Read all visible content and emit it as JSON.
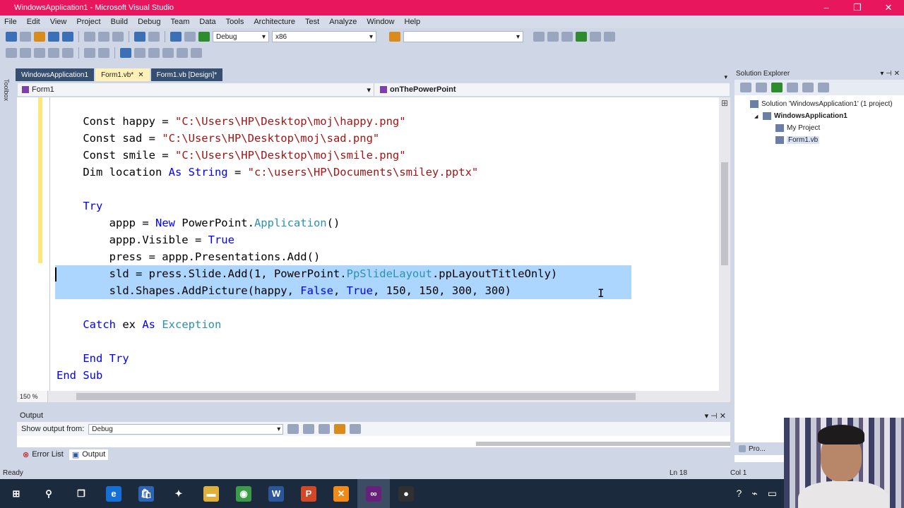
{
  "window": {
    "title": "WindowsApplication1 - Microsoft Visual Studio",
    "controls": [
      "–",
      "❐",
      "✕"
    ]
  },
  "menu": [
    "File",
    "Edit",
    "View",
    "Project",
    "Build",
    "Debug",
    "Team",
    "Data",
    "Tools",
    "Architecture",
    "Test",
    "Analyze",
    "Window",
    "Help"
  ],
  "toolbar": {
    "config": "Debug",
    "platform": "x86",
    "find": ""
  },
  "toolbox_label": "Toolbox",
  "tabs": [
    {
      "label": "WindowsApplication1",
      "active": false
    },
    {
      "label": "Form1.vb*",
      "active": true
    },
    {
      "label": "Form1.vb [Design]*",
      "active": false
    }
  ],
  "navbar": {
    "left": "Form1",
    "right": "onThePowerPoint"
  },
  "code": {
    "lines": [
      [
        {
          "t": "    Const happy = "
        },
        {
          "t": "\"C:\\Users\\HP\\Desktop\\moj\\happy.png\"",
          "c": "str"
        }
      ],
      [
        {
          "t": "    Const sad = "
        },
        {
          "t": "\"C:\\Users\\HP\\Desktop\\moj\\sad.png\"",
          "c": "str"
        }
      ],
      [
        {
          "t": "    Const smile = "
        },
        {
          "t": "\"C:\\Users\\HP\\Desktop\\moj\\smile.png\"",
          "c": "str"
        }
      ],
      [
        {
          "t": "    Dim location ",
          "c": ""
        },
        {
          "t": "As String",
          "c": "kw"
        },
        {
          "t": " = "
        },
        {
          "t": "\"c:\\users\\HP\\Documents\\smiley.pptx\"",
          "c": "str"
        }
      ],
      [
        {
          "t": ""
        }
      ],
      [
        {
          "t": "    Try",
          "c": "kw"
        }
      ],
      [
        {
          "t": "        appp = "
        },
        {
          "t": "New",
          "c": "kw"
        },
        {
          "t": " PowerPoint."
        },
        {
          "t": "Application",
          "c": "ty"
        },
        {
          "t": "()"
        }
      ],
      [
        {
          "t": "        appp.Visible = "
        },
        {
          "t": "True",
          "c": "kw"
        }
      ],
      [
        {
          "t": "        press = appp.Presentations.Add()"
        }
      ],
      [
        {
          "t": "        sld = press.Slide.Add(1, PowerPoint."
        },
        {
          "t": "PpSlideLayout",
          "c": "ty"
        },
        {
          "t": ".ppLayoutTitleOnly)"
        }
      ],
      [
        {
          "t": "        sld.Shapes.AddPicture(happy, "
        },
        {
          "t": "False",
          "c": "kw"
        },
        {
          "t": ", "
        },
        {
          "t": "True",
          "c": "kw"
        },
        {
          "t": ", 150, 150, 300, 300)"
        }
      ],
      [
        {
          "t": ""
        }
      ],
      [
        {
          "t": "    Catch",
          "c": "kw"
        },
        {
          "t": " ex "
        },
        {
          "t": "As",
          "c": "kw"
        },
        {
          "t": " "
        },
        {
          "t": "Exception",
          "c": "ty"
        }
      ],
      [
        {
          "t": ""
        }
      ],
      [
        {
          "t": "    End Try",
          "c": "kw"
        }
      ],
      [
        {
          "t": "End Sub",
          "c": "kw"
        }
      ]
    ]
  },
  "zoom": "150 %",
  "solution_explorer": {
    "title": "Solution Explorer",
    "items": [
      {
        "label": "Solution 'WindowsApplication1' (1 project)",
        "indent": 0,
        "bold": false,
        "selected": false
      },
      {
        "label": "WindowsApplication1",
        "indent": 1,
        "bold": true,
        "selected": false
      },
      {
        "label": "My Project",
        "indent": 2,
        "bold": false,
        "selected": false
      },
      {
        "label": "Form1.vb",
        "indent": 2,
        "bold": false,
        "selected": true
      }
    ],
    "bottom_tab": "Pro..."
  },
  "output": {
    "title": "Output",
    "show_from_label": "Show output from:",
    "show_from_value": "Debug"
  },
  "panel_tabs": [
    {
      "label": "Error List",
      "active": false
    },
    {
      "label": "Output",
      "active": true
    }
  ],
  "status": {
    "text": "Ready",
    "ln": "Ln 18",
    "col": "Col 1"
  },
  "taskbar": [
    {
      "name": "start",
      "glyph": "⊞",
      "color": "#1b2a3c"
    },
    {
      "name": "search",
      "glyph": "⚲",
      "color": "#1b2a3c"
    },
    {
      "name": "task-view",
      "glyph": "❐",
      "color": "#1b2a3c"
    },
    {
      "name": "edge",
      "glyph": "e",
      "color": "#1570d6"
    },
    {
      "name": "store",
      "glyph": "🛍",
      "color": "#2f64b5"
    },
    {
      "name": "dropbox",
      "glyph": "✦",
      "color": "#1b2a3c"
    },
    {
      "name": "explorer",
      "glyph": "▬",
      "color": "#e0b13a"
    },
    {
      "name": "chrome",
      "glyph": "◉",
      "color": "#3b9b46"
    },
    {
      "name": "word",
      "glyph": "W",
      "color": "#2b579a"
    },
    {
      "name": "powerpoint",
      "glyph": "P",
      "color": "#d24726"
    },
    {
      "name": "xampp",
      "glyph": "✕",
      "color": "#f28a18"
    },
    {
      "name": "visual-studio",
      "glyph": "∞",
      "color": "#68217a"
    },
    {
      "name": "obs",
      "glyph": "●",
      "color": "#303030"
    }
  ],
  "colors": {
    "accent": "#e8175d",
    "keyword": "#0000ff",
    "string": "#a31515",
    "type": "#2b91af",
    "selection": "#add6ff"
  }
}
